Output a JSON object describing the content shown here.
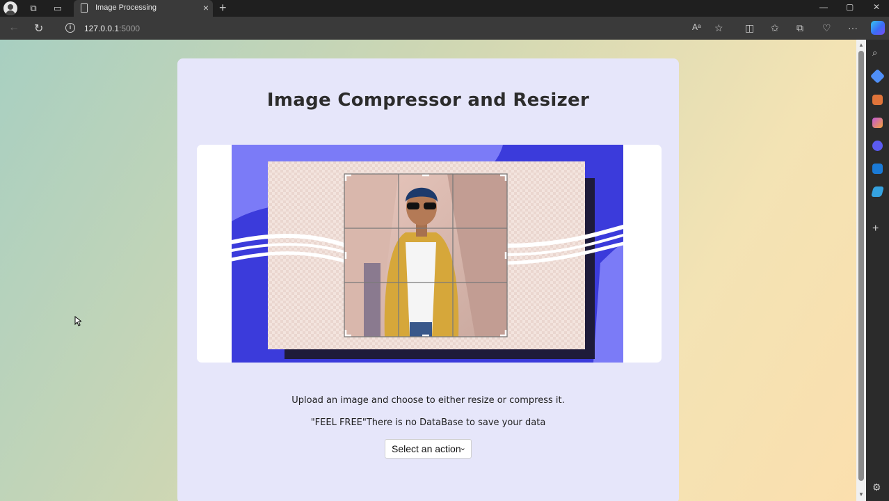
{
  "browser": {
    "tab_title": "Image Processing",
    "tab_close": "×",
    "new_tab": "+",
    "url_host": "127.0.0.1",
    "url_port": ":5000",
    "window_controls": [
      "—",
      "▢",
      "✕"
    ]
  },
  "page": {
    "heading": "Image Compressor and Resizer",
    "description_1": "Upload an image and choose to either resize or compress it.",
    "description_2": "\"FEEL FREE\"There is no DataBase to save your data",
    "select": {
      "value": "Select an action",
      "chevron": "⌄"
    }
  },
  "icons": {
    "back": "back-arrow-icon",
    "refresh": "refresh-icon",
    "info": "site-info-icon",
    "read_aloud": "read-aloud-icon",
    "favorite": "star-icon",
    "split": "split-screen-icon",
    "favorites": "favorites-icon",
    "collections": "collections-icon",
    "health": "browser-essentials-icon",
    "more": "more-icon",
    "copilot": "copilot-icon"
  },
  "colors": {
    "card_bg": "#e6e6fa",
    "hero_blue": "#3b3bdb",
    "hero_light_blue": "#7b7bf7",
    "page_gradient_start": "#a8cfc1",
    "page_gradient_end": "#fbdfae"
  }
}
